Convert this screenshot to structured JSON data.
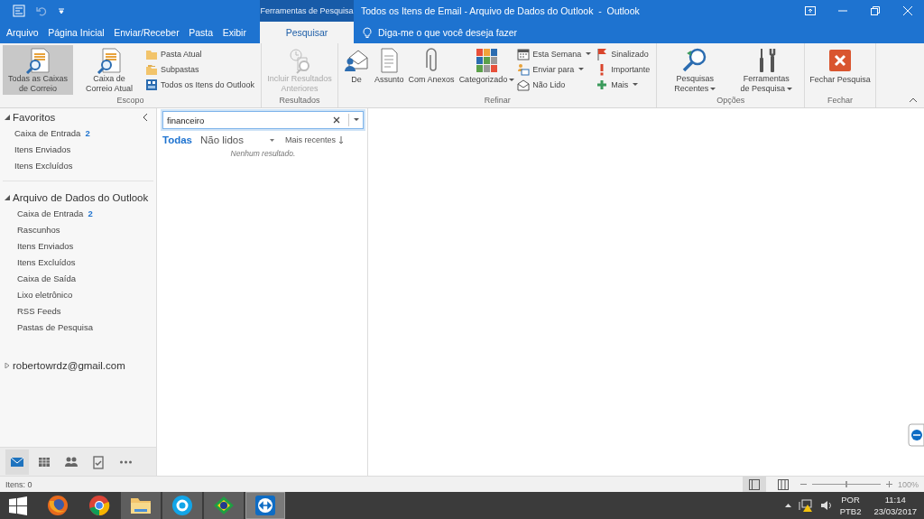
{
  "title_bar": {
    "contextual_group": "Ferramentas de Pesquisa",
    "title": "Todos os Itens de Email - Arquivo de Dados do Outlook  -  Outlook"
  },
  "tabs": [
    {
      "label": "Arquivo",
      "kind": "file",
      "selected": false
    },
    {
      "label": "Página Inicial",
      "kind": "normal",
      "selected": false
    },
    {
      "label": "Enviar/Receber",
      "kind": "normal",
      "selected": false
    },
    {
      "label": "Pasta",
      "kind": "normal",
      "selected": false
    },
    {
      "label": "Exibir",
      "kind": "normal",
      "selected": false
    },
    {
      "label": "Pesquisar",
      "kind": "contextual",
      "selected": true
    }
  ],
  "tell_me": {
    "placeholder": "Diga-me o que você deseja fazer"
  },
  "ribbon": {
    "groups": [
      {
        "label": "Escopo",
        "items": [
          {
            "kind": "large",
            "label": "Todas as Caixas de Correio",
            "selected": true,
            "disabled": false,
            "dropdown": false
          },
          {
            "kind": "large",
            "label": "Caixa de Correio Atual",
            "selected": false,
            "disabled": false,
            "dropdown": false
          },
          {
            "kind": "small",
            "label": "Pasta Atual",
            "selected": false,
            "disabled": false,
            "dropdown": false
          },
          {
            "kind": "small",
            "label": "Subpastas",
            "selected": false,
            "disabled": false,
            "dropdown": false
          },
          {
            "kind": "small",
            "label": "Todos os Itens do Outlook",
            "selected": false,
            "disabled": false,
            "dropdown": false
          }
        ]
      },
      {
        "label": "Resultados",
        "items": [
          {
            "kind": "large",
            "label": "Incluir Resultados Anteriores",
            "selected": false,
            "disabled": true,
            "dropdown": false
          }
        ]
      },
      {
        "label": "Refinar",
        "items": [
          {
            "kind": "large",
            "label": "De",
            "selected": false,
            "disabled": false,
            "dropdown": false
          },
          {
            "kind": "large",
            "label": "Assunto",
            "selected": false,
            "disabled": false,
            "dropdown": false
          },
          {
            "kind": "large",
            "label": "Com Anexos",
            "selected": false,
            "disabled": false,
            "dropdown": false
          },
          {
            "kind": "large",
            "label": "Categorizado",
            "selected": false,
            "disabled": false,
            "dropdown": true
          },
          {
            "kind": "small",
            "label": "Esta Semana",
            "selected": false,
            "disabled": false,
            "dropdown": true
          },
          {
            "kind": "small",
            "label": "Enviar para",
            "selected": false,
            "disabled": false,
            "dropdown": true
          },
          {
            "kind": "small",
            "label": "Não Lido",
            "selected": false,
            "disabled": false,
            "dropdown": false
          },
          {
            "kind": "small",
            "label": "Sinalizado",
            "selected": false,
            "disabled": false,
            "dropdown": false
          },
          {
            "kind": "small",
            "label": "Importante",
            "selected": false,
            "disabled": false,
            "dropdown": false
          },
          {
            "kind": "small",
            "label": "Mais",
            "selected": false,
            "disabled": false,
            "dropdown": true
          }
        ]
      },
      {
        "label": "Opções",
        "items": [
          {
            "kind": "large",
            "label": "Pesquisas Recentes",
            "selected": false,
            "disabled": false,
            "dropdown": true
          },
          {
            "kind": "large",
            "label": "Ferramentas de Pesquisa",
            "selected": false,
            "disabled": false,
            "dropdown": true
          }
        ]
      },
      {
        "label": "Fechar",
        "items": [
          {
            "kind": "large",
            "label": "Fechar Pesquisa",
            "selected": false,
            "disabled": false,
            "dropdown": false
          }
        ]
      }
    ]
  },
  "folder_pane": {
    "sections": [
      {
        "title": "Favoritos",
        "expanded": true,
        "items": [
          {
            "label": "Caixa de Entrada",
            "count": "2"
          },
          {
            "label": "Itens Enviados"
          },
          {
            "label": "Itens Excluídos"
          }
        ]
      },
      {
        "title": "Arquivo de Dados do Outlook",
        "expanded": true,
        "items": [
          {
            "label": "Caixa de Entrada",
            "count": "2"
          },
          {
            "label": "Rascunhos"
          },
          {
            "label": "Itens Enviados"
          },
          {
            "label": "Itens Excluídos"
          },
          {
            "label": "Caixa de Saída"
          },
          {
            "label": "Lixo eletrônico"
          },
          {
            "label": "RSS Feeds"
          },
          {
            "label": "Pastas de Pesquisa"
          }
        ]
      },
      {
        "title": "robertowrdz@gmail.com",
        "expanded": false
      }
    ]
  },
  "navigation": [
    {
      "selected": true
    },
    {
      "selected": false
    },
    {
      "selected": false
    },
    {
      "selected": false
    },
    {
      "selected": false
    }
  ],
  "search": {
    "value": "financeiro"
  },
  "filters": [
    {
      "label": "Todas",
      "selected": true
    },
    {
      "label": "Não lidos",
      "selected": false
    }
  ],
  "sort": {
    "label": "Mais recentes"
  },
  "message_list": {
    "empty_text": "Nenhum resultado."
  },
  "status_bar": {
    "items": "Itens: 0",
    "views": [
      {
        "selected": true
      },
      {
        "selected": false
      }
    ],
    "zoom": {
      "level": 0.5,
      "label": "100%"
    }
  },
  "taskbar": {
    "apps": [
      {
        "running": false,
        "selected": false
      },
      {
        "running": false,
        "selected": false
      },
      {
        "running": false,
        "selected": false
      },
      {
        "running": true,
        "selected": false
      },
      {
        "running": true,
        "selected": false
      },
      {
        "running": true,
        "selected": false
      },
      {
        "running": true,
        "selected": true
      }
    ],
    "tray": {
      "language": "POR",
      "layout": "PTB2",
      "time": "11:14",
      "date": "23/03/2017"
    }
  }
}
